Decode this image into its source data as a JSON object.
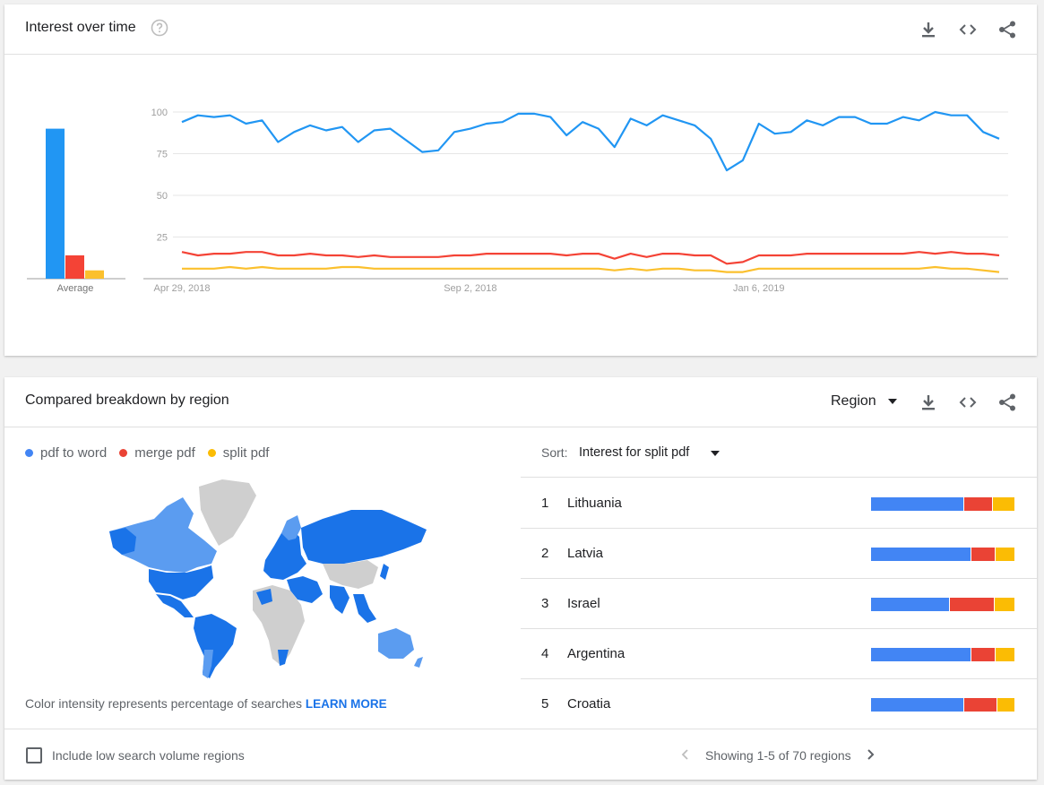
{
  "interest_card": {
    "title": "Interest over time",
    "icons": [
      "help-icon",
      "download-icon",
      "embed-icon",
      "share-icon"
    ],
    "average_label": "Average"
  },
  "chart_data": {
    "type": "line",
    "title": "Interest over time",
    "ylim": [
      0,
      100
    ],
    "y_ticks": [
      100,
      75,
      50,
      25
    ],
    "x_tick_labels": [
      "Apr 29, 2018",
      "Sep 2, 2018",
      "Jan 6, 2019"
    ],
    "grid": true,
    "series": [
      {
        "name": "pdf to word",
        "color": "#2196f3",
        "average": 90,
        "values": [
          94,
          98,
          97,
          98,
          93,
          95,
          82,
          88,
          92,
          89,
          91,
          82,
          89,
          90,
          83,
          76,
          77,
          88,
          90,
          93,
          94,
          99,
          99,
          97,
          86,
          94,
          90,
          79,
          96,
          92,
          98,
          95,
          92,
          84,
          65,
          71,
          93,
          87,
          88,
          95,
          92,
          97,
          97,
          93,
          93,
          97,
          95,
          100,
          98,
          98,
          88,
          84
        ]
      },
      {
        "name": "merge pdf",
        "color": "#f44336",
        "average": 14,
        "values": [
          16,
          14,
          15,
          15,
          16,
          16,
          14,
          14,
          15,
          14,
          14,
          13,
          14,
          13,
          13,
          13,
          13,
          14,
          14,
          15,
          15,
          15,
          15,
          15,
          14,
          15,
          15,
          12,
          15,
          13,
          15,
          15,
          14,
          14,
          9,
          10,
          14,
          14,
          14,
          15,
          15,
          15,
          15,
          15,
          15,
          15,
          16,
          15,
          16,
          15,
          15,
          14
        ]
      },
      {
        "name": "split pdf",
        "color": "#fbc02d",
        "average": 5,
        "values": [
          6,
          6,
          6,
          7,
          6,
          7,
          6,
          6,
          6,
          6,
          7,
          7,
          6,
          6,
          6,
          6,
          6,
          6,
          6,
          6,
          6,
          6,
          6,
          6,
          6,
          6,
          6,
          5,
          6,
          5,
          6,
          6,
          5,
          5,
          4,
          4,
          6,
          6,
          6,
          6,
          6,
          6,
          6,
          6,
          6,
          6,
          6,
          7,
          6,
          6,
          5,
          4
        ]
      }
    ]
  },
  "region_card": {
    "title": "Compared breakdown by region",
    "region_select": "Region",
    "legend": [
      {
        "label": "pdf to word",
        "color": "#4285f4"
      },
      {
        "label": "merge pdf",
        "color": "#ea4335"
      },
      {
        "label": "split pdf",
        "color": "#fbbc04"
      }
    ],
    "map_note": "Color intensity represents percentage of searches",
    "learn_more": "LEARN MORE",
    "sort_label": "Sort:",
    "sort_value": "Interest for split pdf",
    "ranking": [
      {
        "rank": "1",
        "name": "Lithuania",
        "shares": [
          65,
          20,
          15
        ]
      },
      {
        "rank": "2",
        "name": "Latvia",
        "shares": [
          70,
          17,
          13
        ]
      },
      {
        "rank": "3",
        "name": "Israel",
        "shares": [
          55,
          31,
          14
        ]
      },
      {
        "rank": "4",
        "name": "Argentina",
        "shares": [
          70,
          17,
          13
        ]
      },
      {
        "rank": "5",
        "name": "Croatia",
        "shares": [
          65,
          23,
          12
        ]
      }
    ],
    "checkbox_label": "Include low search volume regions",
    "checkbox_checked": false,
    "pager_text": "Showing 1-5 of 70 regions"
  },
  "colors": {
    "blue_bar": "#4285f4",
    "red_bar": "#ea4335",
    "yellow_bar": "#fbbc04",
    "map_blue_dark": "#1a73e8",
    "map_blue_light": "#5b9cf0",
    "map_grey": "#cfcfcf"
  }
}
